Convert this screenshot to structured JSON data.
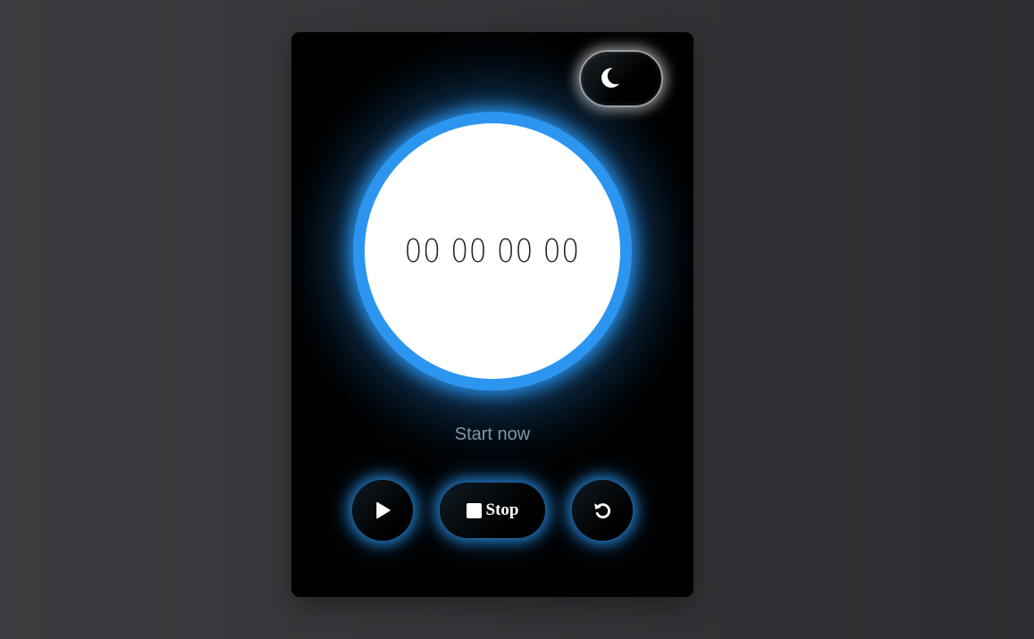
{
  "theme_toggle": {
    "icon": "moon-icon",
    "mode": "dark"
  },
  "timer": {
    "display": "00 00 00 00"
  },
  "status": {
    "text": "Start now"
  },
  "controls": {
    "play": {
      "icon": "play-icon"
    },
    "stop": {
      "icon": "stop-square-icon",
      "label": "Stop"
    },
    "reset": {
      "icon": "reset-icon"
    }
  },
  "colors": {
    "accent": "#2b95f0",
    "card_background": "#000000",
    "page_background": "#333538",
    "status_text": "#7f96a8"
  }
}
